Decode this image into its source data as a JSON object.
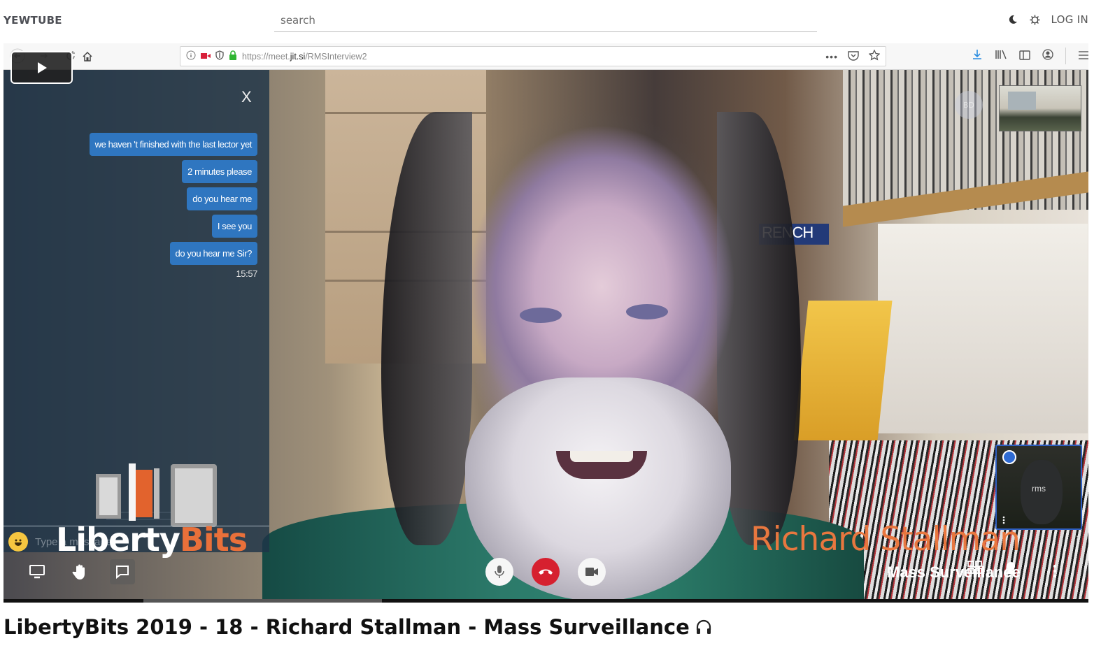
{
  "header": {
    "logo": "YEWTUBE",
    "search_placeholder": "search",
    "search_value": "",
    "theme_icon": "moon-icon",
    "settings_icon": "gear-icon",
    "login_label": "LOG IN"
  },
  "player": {
    "play_icon": "play-icon",
    "progress": {
      "played_fraction": 0.0,
      "buffered_fraction": 0.22
    },
    "browser": {
      "url_protocol": "https://meet.",
      "url_domain": "jit.si",
      "url_path": "/RMSInterview2",
      "nav_icons": [
        "back-icon",
        "forward-icon",
        "reload-icon",
        "home-icon"
      ],
      "url_icons": [
        "info-icon",
        "camera-icon",
        "shield-icon",
        "lock-icon"
      ],
      "url_actions": [
        "more-icon",
        "pocket-icon",
        "bookmark-star-icon"
      ],
      "toolbar_icons": [
        "download-icon",
        "library-icon",
        "sidebar-icon",
        "account-icon",
        "menu-icon"
      ]
    },
    "chat": {
      "close_label": "X",
      "messages": [
        "we haven 't finished with the last lector yet",
        "2 minutes please",
        "do you hear me",
        "I see you",
        "do you hear me Sir?"
      ],
      "timestamp": "15:57",
      "input_placeholder": "Type a message"
    },
    "branding": {
      "liberty": "Liberty",
      "bits": "Bits",
      "accent": "#e9703a"
    },
    "lower_third": {
      "speaker": "Richard Stallman",
      "topic": "Mass Surveillance"
    },
    "thumbnails": {
      "self_label": "rms",
      "avatar_initials": "BD"
    },
    "jitsi_toolbar": {
      "left": [
        "screenshare-icon",
        "raise-hand-icon",
        "chat-icon"
      ],
      "center": [
        "microphone-icon",
        "hangup-icon",
        "video-camera-icon"
      ],
      "right": [
        "tile-view-icon",
        "invite-icon",
        "more-vertical-icon"
      ]
    },
    "colors": {
      "chat_bubble": "#2f76c0",
      "hangup": "#d6202f",
      "speaker_name": "#e8773f"
    }
  },
  "video": {
    "title": "LibertyBits 2019 - 18 - Richard Stallman - Mass Surveillance",
    "title_icon": "headphones-icon"
  }
}
